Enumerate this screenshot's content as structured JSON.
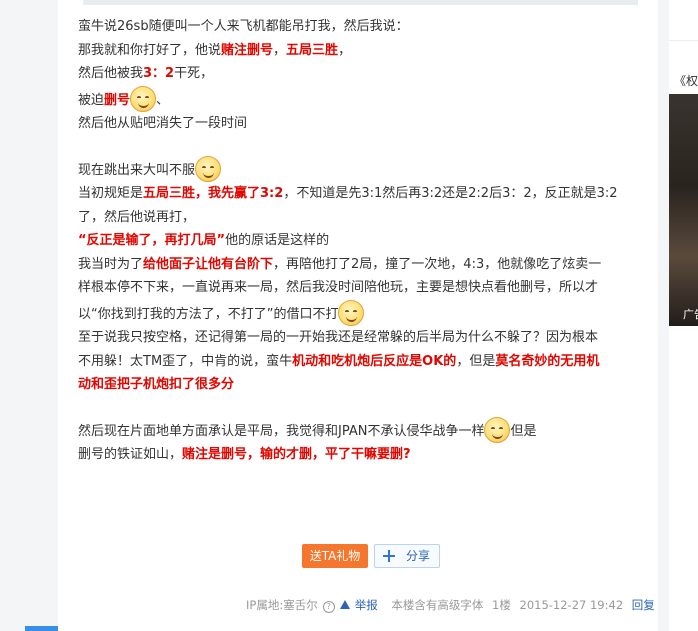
{
  "post": {
    "lines": [
      {
        "parts": [
          {
            "t": "蛮牛说26sb随便叫一个人来飞机都能吊打我，然后我说："
          }
        ]
      },
      {
        "parts": [
          {
            "t": "那我就和你打好了，他说"
          },
          {
            "t": "赌注删号",
            "red": true
          },
          {
            "t": "，"
          },
          {
            "t": "五局三胜",
            "red": true
          },
          {
            "t": "，"
          }
        ]
      },
      {
        "parts": [
          {
            "t": "然后他被我"
          },
          {
            "t": "3：2",
            "red": true
          },
          {
            "t": "干死，"
          }
        ]
      },
      {
        "parts": [
          {
            "t": "被迫"
          },
          {
            "t": "删号",
            "red": true
          },
          {
            "smile": true
          },
          {
            "t": "、"
          }
        ]
      },
      {
        "parts": [
          {
            "t": "然后他从贴吧消失了一段时间"
          }
        ]
      },
      {
        "gap": true
      },
      {
        "parts": [
          {
            "t": "现在跳出来大叫不服"
          },
          {
            "smile": true
          }
        ]
      },
      {
        "parts": [
          {
            "t": "当初规矩是"
          },
          {
            "t": "五局三胜，我先赢了3:2",
            "red": true
          },
          {
            "t": "，不知道是先3:1然后再3:2还是2:2后3：2，反正就是3:2"
          }
        ]
      },
      {
        "parts": [
          {
            "t": "了，然后他说再打，"
          }
        ]
      },
      {
        "parts": [
          {
            "t": "“反正是输了，再打几局”",
            "red": true
          },
          {
            "t": "他的原话是这样的"
          }
        ]
      },
      {
        "parts": [
          {
            "t": "我当时为了"
          },
          {
            "t": "给他面子让他有台阶下",
            "red": true
          },
          {
            "t": "，再陪他打了2局，撞了一次地，4:3，他就像吃了炫卖一"
          }
        ]
      },
      {
        "parts": [
          {
            "t": "样根本停不下来，一直说再来一局，然后我没时间陪他玩，主要是想快点看他删号，所以才"
          }
        ]
      },
      {
        "parts": [
          {
            "t": "以“你找到打我的方法了，不打了”的借口不打"
          },
          {
            "smile": true
          }
        ]
      },
      {
        "parts": [
          {
            "t": "至于说我只按空格，还记得第一局的一开始我还是经常躲的后半局为什么不躲了？因为根本"
          }
        ]
      },
      {
        "parts": [
          {
            "t": "不用躲！太TM歪了，中肯的说，蛮牛"
          },
          {
            "t": "机动和吃机炮后反应是OK的",
            "red": true
          },
          {
            "t": "，但是"
          },
          {
            "t": "莫名奇妙的无用机",
            "red": true
          }
        ]
      },
      {
        "parts": [
          {
            "t": "动和歪把子机炮扣了很多分",
            "red": true
          }
        ]
      },
      {
        "gap": true
      },
      {
        "parts": [
          {
            "t": "然后现在片面地单方面承认是平局，我觉得和JPAN不承认侵华战争一样"
          },
          {
            "smile": true
          },
          {
            "t": "但是"
          }
        ]
      },
      {
        "parts": [
          {
            "t": "删号的铁证如山，"
          },
          {
            "t": "赌注是删号，输的才删，平了干嘛要删?",
            "red": true
          }
        ]
      }
    ]
  },
  "actions": {
    "gift_label": "送TA礼物",
    "share_label": "分享"
  },
  "footer": {
    "ip_location": "IP属地:塞舌尔",
    "report": "举报",
    "font_note": "本楼含有高级字体",
    "floor": "1楼",
    "datetime": "2015-12-27 19:42",
    "reply": "回复"
  },
  "sidebar": {
    "title_fragment": "《权",
    "image_caption": "广告"
  },
  "colors": {
    "accent_red": "#e10600",
    "gift_orange": "#f5762d",
    "link_blue": "#2d64b3"
  }
}
